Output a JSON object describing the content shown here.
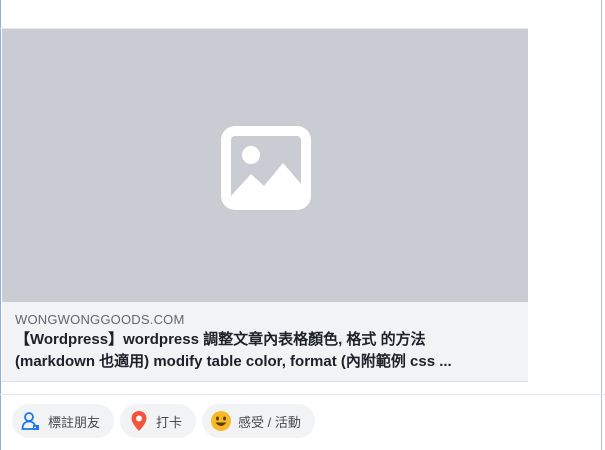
{
  "link_preview": {
    "domain": "WONGWONGGOODS.COM",
    "title_line1": "【Wordpress】wordpress 調整文章內表格顏色, 格式 的方法",
    "title_line2": "(markdown 也適用) modify table color, format (內附範例 css ..."
  },
  "actions": [
    {
      "label": "標註朋友",
      "icon": "tag-friends-icon"
    },
    {
      "label": "打卡",
      "icon": "location-pin-icon"
    },
    {
      "label": "感受 / 活動",
      "icon": "smiley-icon"
    }
  ],
  "colors": {
    "placeholder_bg": "#c9ccd3",
    "card_bg": "#f2f3f5",
    "tag_blue": "#1877f2",
    "pin_red": "#f5533d",
    "smiley_yellow": "#f7b928"
  }
}
